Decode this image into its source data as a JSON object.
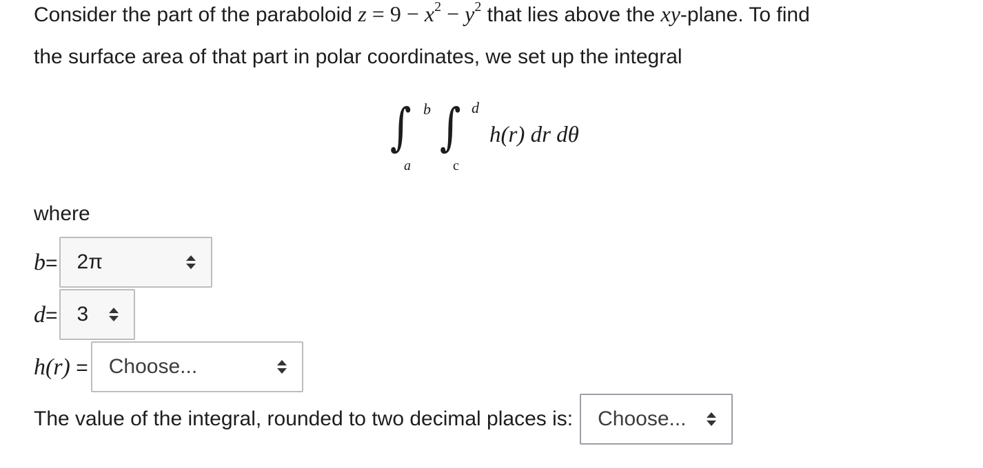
{
  "question": {
    "line1_prefix": "Consider the part of the paraboloid ",
    "eq_z": "z",
    "eq_equals": " = 9 − ",
    "eq_x": "x",
    "eq_minus": " − ",
    "eq_y": "y",
    "exp": "2",
    "line1_mid": " that lies above the ",
    "plane_var": "xy",
    "line1_suffix": "-plane. To find",
    "line2": "the surface area of that part in polar coordinates, we set up the integral"
  },
  "integral": {
    "outer_upper": "b",
    "outer_lower": "a",
    "inner_upper": "d",
    "inner_lower": "c",
    "integrand": "h(r) dr dθ"
  },
  "where_label": "where",
  "fields": {
    "b": {
      "label": "b",
      "equals": "=",
      "value": "2π"
    },
    "d": {
      "label": "d",
      "equals": "=",
      "value": "3"
    },
    "h": {
      "label": "h(r)",
      "equals": " = ",
      "value": "Choose..."
    },
    "value_prompt": "The value of the integral, rounded to two decimal places is:",
    "value_select": "Choose..."
  }
}
